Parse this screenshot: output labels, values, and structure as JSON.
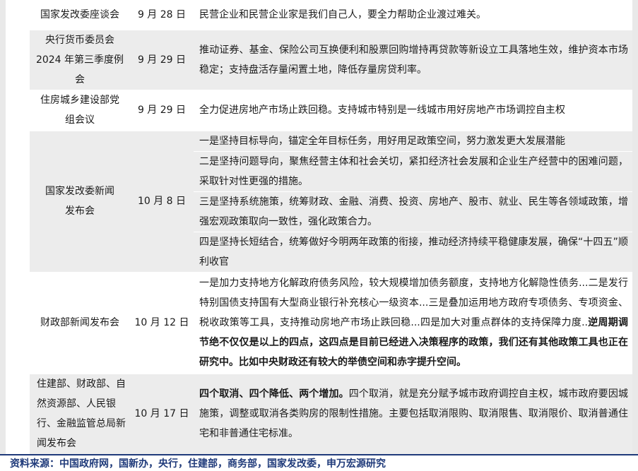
{
  "rows": [
    {
      "org": "国家发改委座谈会",
      "date": "9 月 28 日",
      "content": "民营企业和民营企业家是我们自己人，要全力帮助企业渡过难关。"
    },
    {
      "org": "央行货币委员会2024 年第三季度例会",
      "date": "9 月 29 日",
      "content": "推动证券、基金、保险公司互换便利和股票回购增持再贷款等新设立工具落地生效，维护资本市场稳定；支持盘活存量闲置土地，降低存量房贷利率。"
    },
    {
      "org": "住房城乡建设部党组会议",
      "date": "9 月 29 日",
      "content": "全力促进房地产市场止跌回稳。支持城市特别是一线城市用好房地产市场调控自主权"
    },
    {
      "org": "国家发改委新闻发布会",
      "date": "10 月 8 日",
      "items": [
        "一是坚持目标导向，锚定全年目标任务，用好用足政策空间，努力激发更大发展潜能",
        "二是坚持问题导向，聚焦经营主体和社会关切，紧扣经济社会发展和企业生产经营中的困难问题，采取针对性更强的措施。",
        "三是坚持系统施策，统筹财政、金融、消费、投资、房地产、股市、就业、民生等各领域政策，增强宏观政策取向一致性，强化政策合力。",
        "四是坚持长短结合，统筹做好今明两年政策的衔接，推动经济持续平稳健康发展，确保“十四五”顺利收官"
      ]
    },
    {
      "org": "财政部新闻发布会",
      "date": "10 月 12 日",
      "content": "一是加力支持地方化解政府债务风险，较大规模增加债务额度，支持地方化解隐性债务...二是发行特别国债支持国有大型商业银行补充核心一级资本...三是叠加运用地方政府专项债务、专项资金、税收政策等工具，支持推动房地产市场止跌回稳...四是加大对重点群体的支持保障力度..",
      "content_bold": "逆周期调节绝不仅仅是以上的四点，这四点是目前已经进入决策程序的政策，我们还有其他政策工具也正在研究中。比如中央财政还有较大的举债空间和赤字提升空间。"
    },
    {
      "org": "住建部、财政部、自然资源部、人民银行、金融监管总局新闻发布会",
      "date": "10 月 17 日",
      "content_bold": "四个取消、四个降低、两个增加。",
      "content": "四个取消，就是充分赋予城市政府调控自主权，城市政府要因城施策，调整或取消各类购房的限制性措施。主要包括取消限购、取消限售、取消限价、取消普通住宅和非普通住宅标准。"
    }
  ],
  "footer": "资料来源：中国政府网，国新办，央行，住建部，商务部，国家发改委，申万宏源研究"
}
